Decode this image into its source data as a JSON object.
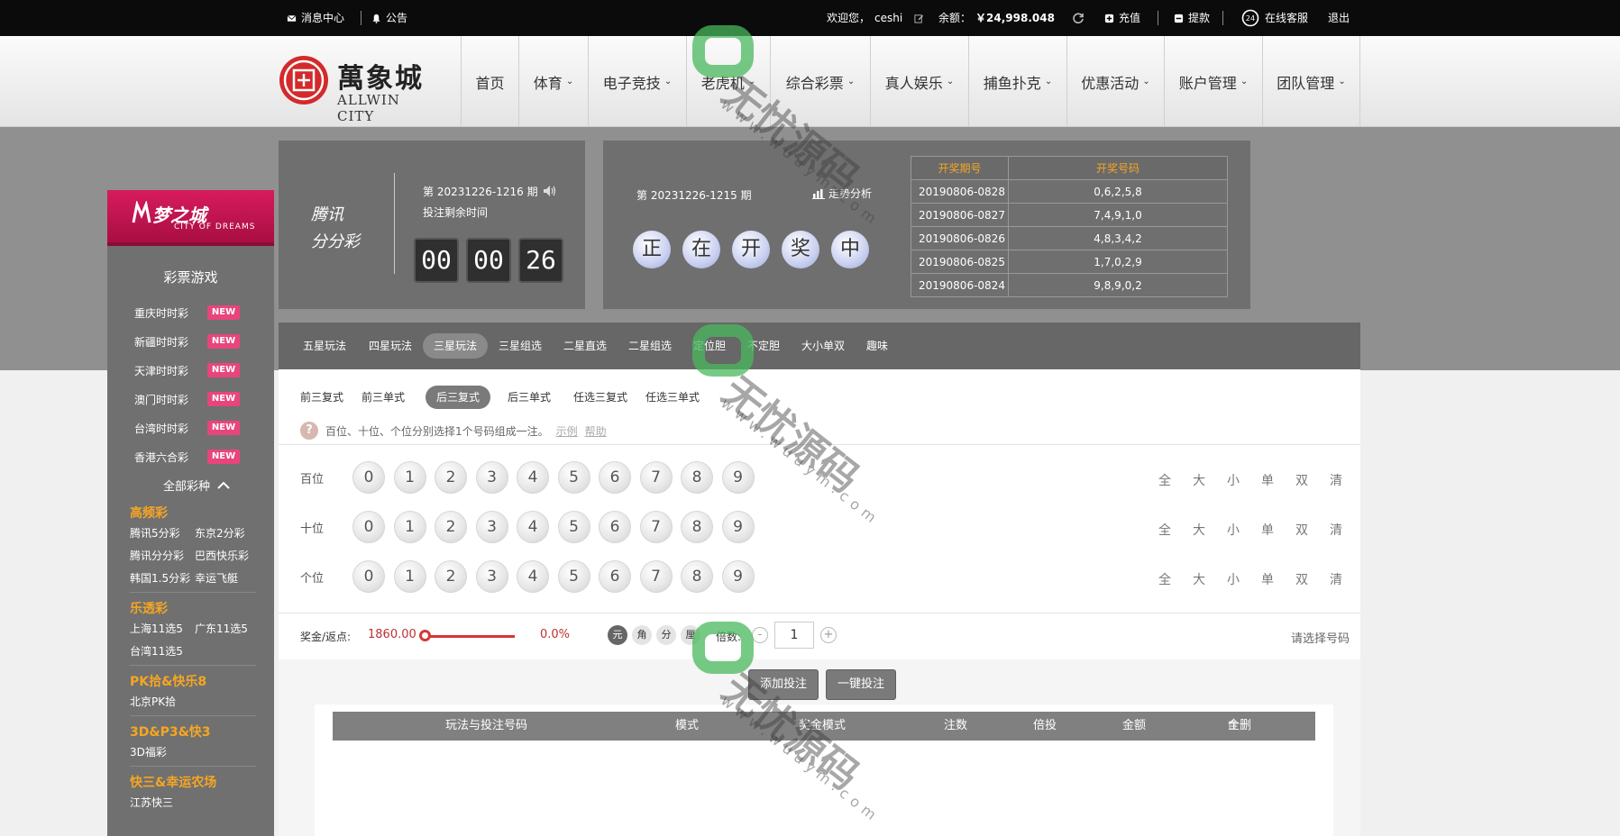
{
  "topbar": {
    "messages": "消息中心",
    "notice": "公告",
    "welcome": "欢迎您，",
    "username": "ceshi",
    "balance_label": "余额：",
    "balance": "￥24,998.048",
    "recharge": "充值",
    "withdraw": "提款",
    "service": "在线客服",
    "logout": "退出"
  },
  "brand": {
    "name_cn": "萬象城",
    "name_en": "ALLWIN CITY"
  },
  "nav": [
    "首页",
    "体育",
    "电子竞技",
    "老虎机",
    "综合彩票",
    "真人娱乐",
    "捕鱼扑克",
    "优惠活动",
    "账户管理",
    "团队管理"
  ],
  "sidebar": {
    "brand_cn": "梦之城",
    "brand_en": "CITY OF DREAMS",
    "title": "彩票游戏",
    "hot": [
      {
        "label": "重庆时时彩",
        "badge": "NEW"
      },
      {
        "label": "新疆时时彩",
        "badge": "NEW"
      },
      {
        "label": "天津时时彩",
        "badge": "NEW"
      },
      {
        "label": "澳门时时彩",
        "badge": "NEW"
      },
      {
        "label": "台湾时时彩",
        "badge": "NEW"
      },
      {
        "label": "香港六合彩",
        "badge": "NEW"
      }
    ],
    "all_kinds": "全部彩种",
    "categories": [
      {
        "title": "高频彩",
        "items": [
          "腾讯5分彩",
          "东京2分彩",
          "腾讯分分彩",
          "巴西快乐彩",
          "韩国1.5分彩",
          "幸运飞艇"
        ]
      },
      {
        "title": "乐透彩",
        "items": [
          "上海11选5",
          "广东11选5",
          "台湾11选5"
        ]
      },
      {
        "title": "PK拾&快乐8",
        "items": [
          "北京PK拾"
        ]
      },
      {
        "title": "3D&P3&快3",
        "items": [
          "3D福彩"
        ]
      },
      {
        "title": "快三&幸运农场",
        "items": [
          "江苏快三"
        ]
      }
    ]
  },
  "game": {
    "name_line1": "腾讯",
    "name_line2": "分分彩",
    "issue": "第 20231226-1216 期",
    "remain_label": "投注剩余时间",
    "timer": [
      "00",
      "00",
      "26"
    ]
  },
  "draw": {
    "prev_issue": "第 20231226-1215 期",
    "trend": "走势分析",
    "status_chars": [
      "正",
      "在",
      "开",
      "奖",
      "中"
    ],
    "history_headers": [
      "开奖期号",
      "开奖号码"
    ],
    "history": [
      [
        "20190806-0828",
        "0,6,2,5,8"
      ],
      [
        "20190806-0827",
        "7,4,9,1,0"
      ],
      [
        "20190806-0826",
        "4,8,3,4,2"
      ],
      [
        "20190806-0825",
        "1,7,0,2,9"
      ],
      [
        "20190806-0824",
        "9,8,9,0,2"
      ]
    ]
  },
  "play_tabs": [
    "五星玩法",
    "四星玩法",
    "三星玩法",
    "三星组选",
    "二星直选",
    "二星组选",
    "定位胆",
    "不定胆",
    "大小单双",
    "趣味"
  ],
  "sub_tabs": [
    "前三复式",
    "前三单式",
    "后三复式",
    "后三单式",
    "任选三复式",
    "任选三单式"
  ],
  "hint": {
    "text": "百位、十位、个位分别选择1个号码组成一注。",
    "example": "示例",
    "help": "帮助"
  },
  "rows": [
    {
      "label": "百位"
    },
    {
      "label": "十位"
    },
    {
      "label": "个位"
    }
  ],
  "numbers": [
    "0",
    "1",
    "2",
    "3",
    "4",
    "5",
    "6",
    "7",
    "8",
    "9"
  ],
  "quick": [
    "全",
    "大",
    "小",
    "单",
    "双",
    "清"
  ],
  "bet": {
    "rebate_label": "奖金/返点:",
    "rebate_value": "1860.00",
    "rebate_pct": "0.0%",
    "rebate_level": 0,
    "units": [
      "元",
      "角",
      "分",
      "厘"
    ],
    "multiplier_label": "倍数:",
    "multiplier": "1",
    "minus": "-",
    "plus": "+",
    "choose_tip": "请选择号码",
    "add_btn": "添加投注",
    "quick_btn": "一键投注"
  },
  "orders": {
    "headers": [
      "玩法与投注号码",
      "模式",
      "奖金模式",
      "注数",
      "倍投",
      "金额",
      "全删"
    ]
  },
  "watermark": {
    "text": "无忧源码",
    "url": "www.wuuym.com"
  },
  "colors": {
    "accent_red": "#d43838",
    "badge_pink": "#e8457c",
    "category_gold": "#f5a623"
  }
}
